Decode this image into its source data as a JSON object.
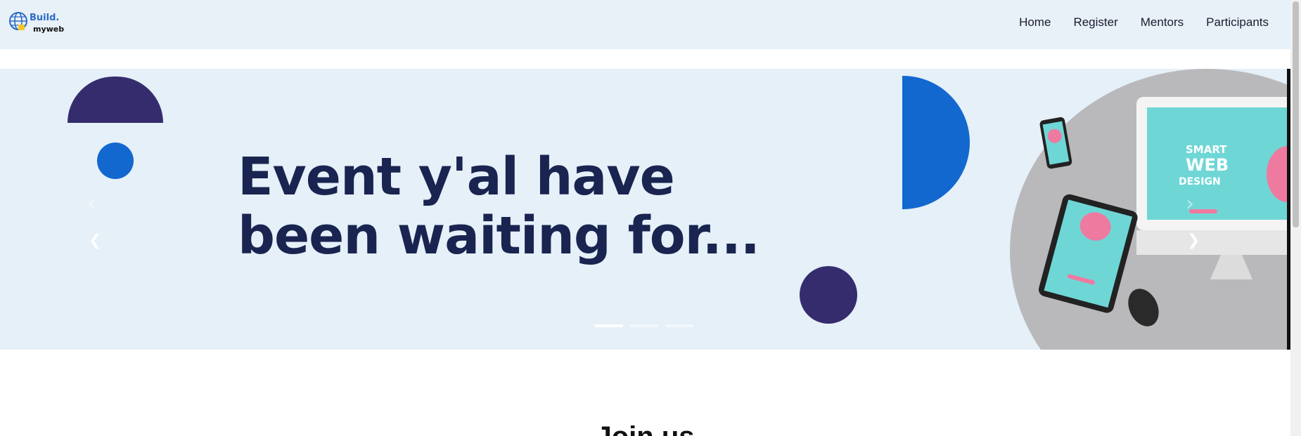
{
  "navbar": {
    "logo": {
      "line1": "Build.",
      "line2": "myweb",
      "icon": "globe-icon"
    },
    "links": [
      "Home",
      "Register",
      "Mentors",
      "Participants"
    ]
  },
  "carousel": {
    "heading_line1": "Event y'al have",
    "heading_line2": "been waiting for...",
    "device_screen_text": "SMART WEB DESIGN",
    "indicators": 3,
    "active_indicator": 0,
    "prev_icon": "chevron-left-icon",
    "next_icon": "chevron-right-icon"
  },
  "section": {
    "title": "Join us"
  },
  "colors": {
    "navbar_bg": "#e8f0f8",
    "hero_bg": "#e5f0f8",
    "heading": "#1a2450",
    "accent_blue": "#1368cf",
    "accent_purple": "#352c6e"
  }
}
